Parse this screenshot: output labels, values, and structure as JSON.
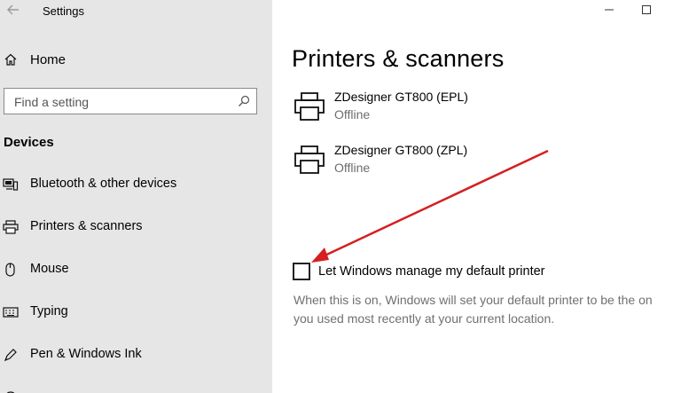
{
  "window": {
    "title": "Settings",
    "back_icon": "back-arrow-icon",
    "minimize_icon": "minimize-icon",
    "maximize_icon": "maximize-icon"
  },
  "sidebar": {
    "home_label": "Home",
    "search_placeholder": "Find a setting",
    "section_heading": "Devices",
    "items": [
      {
        "label": "Bluetooth & other devices",
        "icon": "bluetooth-devices-icon"
      },
      {
        "label": "Printers & scanners",
        "icon": "printer-icon"
      },
      {
        "label": "Mouse",
        "icon": "mouse-icon"
      },
      {
        "label": "Typing",
        "icon": "keyboard-icon"
      },
      {
        "label": "Pen & Windows Ink",
        "icon": "pen-icon"
      }
    ]
  },
  "main": {
    "title": "Printers & scanners",
    "printers": [
      {
        "name": "ZDesigner GT800 (EPL)",
        "status": "Offline"
      },
      {
        "name": "ZDesigner GT800 (ZPL)",
        "status": "Offline"
      }
    ],
    "default_printer": {
      "label": "Let Windows manage my default printer",
      "checked": false,
      "description_line1": "When this is on, Windows will set your default printer to be the on",
      "description_line2": "you used most recently at your current location."
    }
  },
  "colors": {
    "sidebar_bg": "#e6e6e6",
    "annotation_arrow": "#d42020",
    "secondary_text": "#6d6d6d"
  }
}
